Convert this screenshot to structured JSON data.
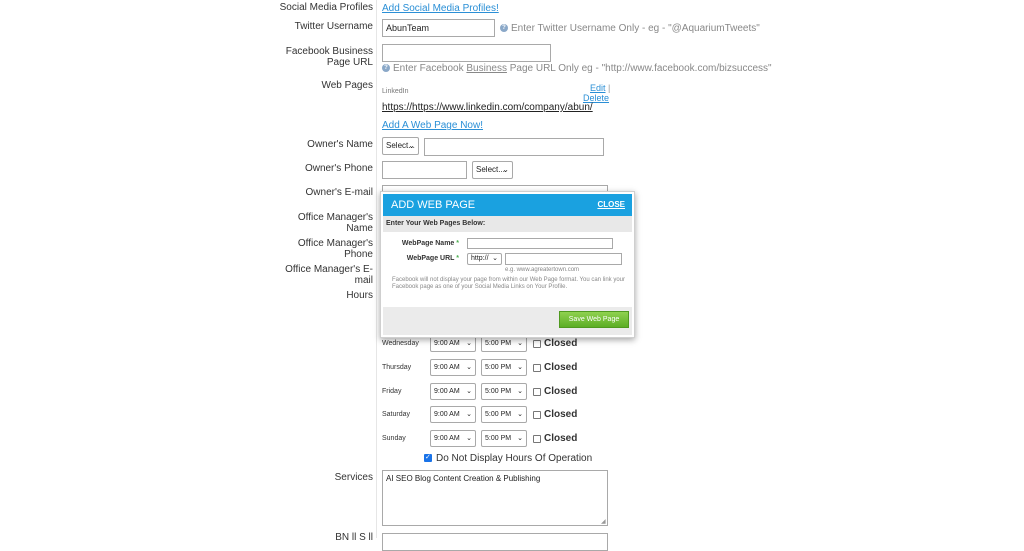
{
  "labels": {
    "social": "Social Media Profiles",
    "twitter": "Twitter Username",
    "fb_line1": "Facebook Business",
    "fb_line2": "Page URL",
    "web_pages": "Web Pages",
    "owner_name": "Owner's Name",
    "owner_phone": "Owner's Phone",
    "owner_email": "Owner's E-mail",
    "office_name_1": "Office Manager's",
    "office_name_2": "Name",
    "office_phone_1": "Office Manager's",
    "office_phone_2": "Phone",
    "office_email_1": "Office Manager's E-",
    "office_email_2": "mail",
    "hours": "Hours",
    "services": "Services",
    "bottom_partial": "BN     ll    S  ll"
  },
  "social": {
    "add_link": "Add Social Media Profiles!"
  },
  "twitter": {
    "value": "AbunTeam",
    "hint": "Enter Twitter Username Only - eg - \"@AquariumTweets\""
  },
  "facebook": {
    "value": "",
    "hint_pre": "Enter Facebook ",
    "hint_link": "Business",
    "hint_post": " Page URL Only eg - \"http://www.facebook.com/bizsuccess\""
  },
  "webpages": {
    "caption": "LinkedIn",
    "url": "https://https://www.linkedin.com/company/abun/",
    "edit": "Edit",
    "delete": "Delete",
    "add": "Add A Web Page Now!"
  },
  "owner": {
    "name_select": "Select...",
    "name_value": "",
    "phone_value": "",
    "phone_select": "Select..."
  },
  "modal": {
    "title": "ADD WEB PAGE",
    "close": "CLOSE",
    "subtitle": "Enter Your Web Pages Below:",
    "name_label": "WebPage Name",
    "url_label": "WebPage URL",
    "required_mark": "*",
    "protocol": "http://",
    "example": "e.g. www.agreatertown.com",
    "note": "Facebook will not display your page from within our Web Page format. You can link your Facebook page as one of your Social Media Links on Your Profile.",
    "save": "Save Web Page"
  },
  "hours": {
    "closed_label": "Closed",
    "days": [
      {
        "day": "Wednesday",
        "open": "9:00 AM",
        "close": "5:00 PM"
      },
      {
        "day": "Thursday",
        "open": "9:00 AM",
        "close": "5:00 PM"
      },
      {
        "day": "Friday",
        "open": "9:00 AM",
        "close": "5:00 PM"
      },
      {
        "day": "Saturday",
        "open": "9:00 AM",
        "close": "5:00 PM"
      },
      {
        "day": "Sunday",
        "open": "9:00 AM",
        "close": "5:00 PM"
      }
    ],
    "do_not_display": "Do Not Display Hours Of Operation",
    "do_not_display_checked": true
  },
  "services": {
    "value": "AI SEO Blog Content Creation & Publishing"
  }
}
